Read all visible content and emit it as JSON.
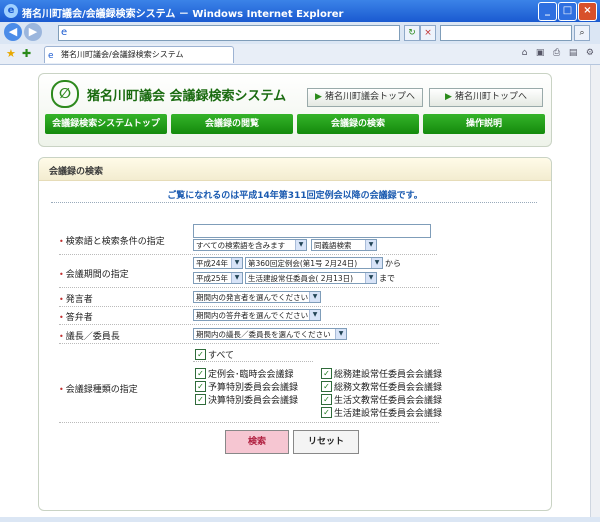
{
  "window": {
    "title": "猪名川町議会/会議録検索システム － Windows Internet Explorer",
    "minimize": "_",
    "maximize": "□",
    "close": "×"
  },
  "browser": {
    "address_value": "",
    "tab_label": "猪名川町議会/会議録検索システム",
    "icons": [
      "back-icon",
      "forward-icon",
      "refresh-icon",
      "stop-icon",
      "search-icon",
      "favorites-star-icon",
      "home-icon",
      "feed-icon",
      "print-icon",
      "page-icon",
      "tools-icon"
    ]
  },
  "header": {
    "site_title": "猪名川町議会 会議録検索システム",
    "link_council_top": "猪名川町議会トップへ",
    "link_town_top": "猪名川町トップへ"
  },
  "nav": {
    "items": [
      "会議録検索システムトップ",
      "会議録の閲覧",
      "会議録の検索",
      "操作説明"
    ]
  },
  "panel": {
    "title": "会議録の検索",
    "notice": "ご覧になれるのは平成14年第311回定例会以降の会議録です。"
  },
  "form": {
    "keyword": {
      "label": "検索語と検索条件の指定",
      "value": "",
      "condition": "すべての検索語を含みます",
      "synonym": "同義語検索"
    },
    "period": {
      "label": "会議期間の指定",
      "from_year": "平成24年",
      "from_meeting": "第360回定例会(第1号 2月24日)",
      "from_suffix": "から",
      "to_year": "平成25年",
      "to_meeting": "生活建設常任委員会( 2月13日)",
      "to_suffix": "まで"
    },
    "speaker": {
      "label": "発言者",
      "value": "期間内の発言者を選んでください"
    },
    "answerer": {
      "label": "答弁者",
      "value": "期間内の答弁者を選んでください"
    },
    "chair": {
      "label": "議長／委員長",
      "value": "期間内の議長／委員長を選んでください"
    },
    "types": {
      "label": "会議録種類の指定",
      "all": "すべて",
      "left": [
        "定例会･臨時会会議録",
        "予算特別委員会会議録",
        "決算特別委員会会議録"
      ],
      "right": [
        "総務建設常任委員会会議録",
        "総務文教常任委員会会議録",
        "生活文教常任委員会会議録",
        "生活建設常任委員会会議録"
      ]
    },
    "search_button": "検索",
    "reset_button": "リセット"
  },
  "colors": {
    "title_bar": "#1a5ad0",
    "nav_green": "#148a0c",
    "site_title": "#1a6b10",
    "notice_blue": "#1a5ab0",
    "search_button": "#f6c6d2",
    "reset_button": "#f4f4f4"
  }
}
